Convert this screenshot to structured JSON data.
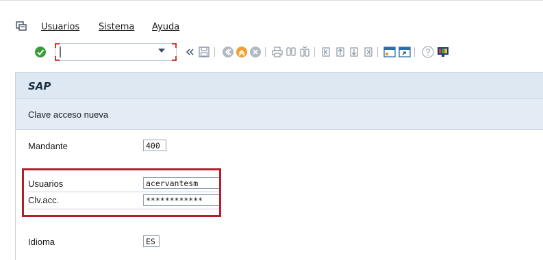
{
  "menubar": {
    "items": [
      {
        "label": "Usuarios"
      },
      {
        "label": "Sistema"
      },
      {
        "label": "Ayuda"
      }
    ]
  },
  "toolbar": {
    "command_value": "",
    "icons": [
      "enter-check-icon",
      "dropdown-arrow-icon",
      "collapse-chevrons-icon",
      "save-icon",
      "back-icon",
      "exit-icon",
      "cancel-icon",
      "print-icon",
      "find-icon",
      "find-next-icon",
      "first-page-icon",
      "previous-page-icon",
      "next-page-icon",
      "last-page-icon",
      "create-session-icon",
      "shortcut-icon",
      "help-icon",
      "customize-layout-icon"
    ]
  },
  "panel": {
    "title": "SAP",
    "subtitle": "Clave acceso nueva"
  },
  "form": {
    "mandante_label": "Mandante",
    "mandante_value": "400",
    "usuarios_label": "Usuarios",
    "usuarios_value": "acervantesm",
    "clave_label": "Clv.acc.",
    "clave_value": "************",
    "idioma_label": "Idioma",
    "idioma_value": "ES"
  },
  "colors": {
    "highlight": "#b21f2b",
    "panel_bg": "#eef3f8",
    "title_bg": "#dde8f3",
    "enter_green": "#3a9a3a",
    "exit_orange": "#f0a030"
  }
}
